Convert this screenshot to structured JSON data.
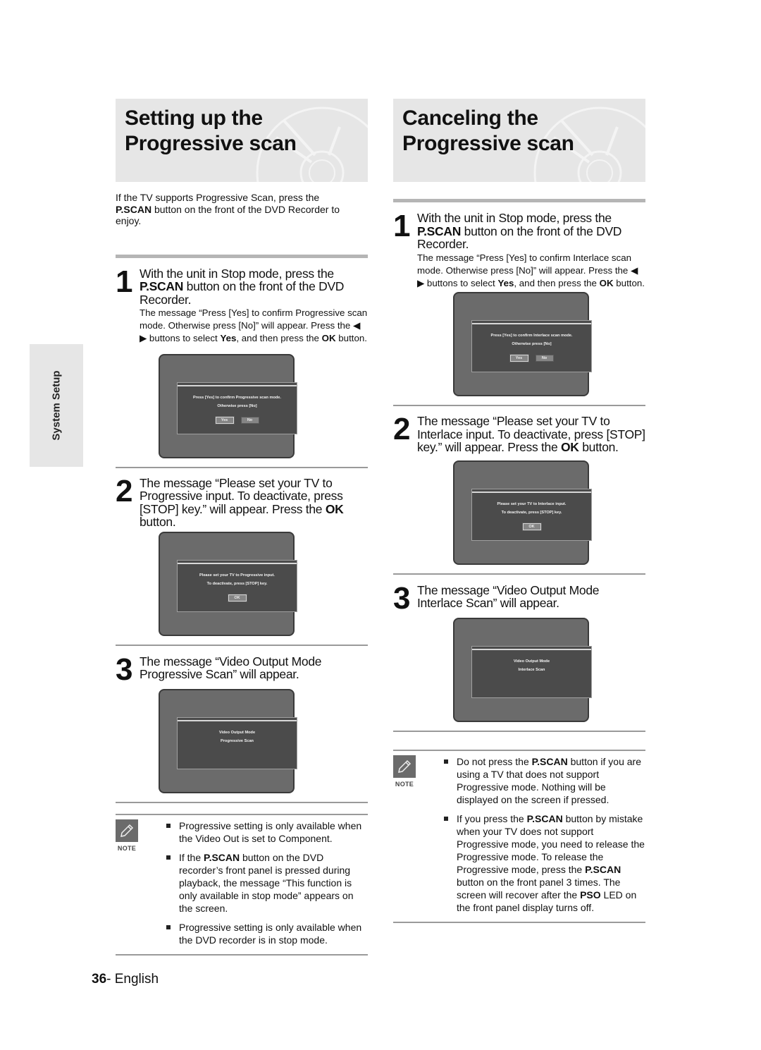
{
  "side_tab": {
    "label": "System Setup"
  },
  "left": {
    "title": "Setting up the Progressive scan",
    "intro_bold": "P.SCAN",
    "intro_pre": "If the TV supports Progressive Scan, press the",
    "intro_post": " button on the front of the DVD Recorder to enjoy.",
    "steps": [
      {
        "num": "1",
        "head_pre": "With the unit in Stop mode, press the",
        "head_bold": "P.SCAN",
        "head_post": " button on the front of the DVD Recorder.",
        "sub_pre": "The message “Press [Yes] to confirm Progressive scan mode. Otherwise press [No]” will appear. Press the ◀ ▶ buttons to select ",
        "sub_bold1": "Yes",
        "sub_mid": ", and then press the ",
        "sub_bold2": "OK",
        "sub_post": " button.",
        "screen": {
          "line1": "Press [Yes] to confirm Progressive scan mode.",
          "line2": "Otherwise press [No]",
          "buttons": [
            "Yes",
            "No"
          ],
          "selected": "Yes"
        }
      },
      {
        "num": "2",
        "head_pre": "The message “Please set your TV to Progressive input. To deactivate, press [STOP] key.” will appear. Press the ",
        "head_bold": "OK",
        "head_post": " button.",
        "screen": {
          "line1": "Please set your TV to Progressive input.",
          "line2": "To deactivate, press [STOP] key.",
          "buttons": [
            "OK"
          ],
          "selected": "OK"
        }
      },
      {
        "num": "3",
        "head_pre": "The message “Video Output Mode Progressive Scan” will appear.",
        "screen": {
          "line1": "Video Output Mode",
          "line2": "Progressive Scan"
        }
      }
    ],
    "note": {
      "label": "NOTE",
      "items": [
        {
          "pre": "Progressive setting is only available when the Video Out is set to Component."
        },
        {
          "pre": "If the ",
          "bold": "P.SCAN",
          "post": " button on the DVD recorder’s front panel is pressed during playback, the message “This function is only available in stop mode” appears on the screen."
        },
        {
          "pre": "Progressive setting is only available when the DVD recorder is in stop mode."
        }
      ]
    }
  },
  "right": {
    "title": "Canceling the Progressive scan",
    "steps": [
      {
        "num": "1",
        "head_pre": "With the unit in Stop mode, press the",
        "head_bold": "P.SCAN",
        "head_post": " button on the front of the DVD Recorder.",
        "sub_pre": "The message “Press [Yes] to confirm Interlace scan mode. Otherwise press [No]” will appear. Press the ◀ ▶ buttons to select ",
        "sub_bold1": "Yes",
        "sub_mid": ", and then press the ",
        "sub_bold2": "OK",
        "sub_post": " button.",
        "screen": {
          "line1": "Press [Yes] to confirm Interlace scan mode.",
          "line2": "Otherwise press [No]",
          "buttons": [
            "Yes",
            "No"
          ],
          "selected": "Yes"
        }
      },
      {
        "num": "2",
        "head_pre": "The message “Please set your TV to Interlace input. To deactivate, press [STOP] key.” will appear. Press the ",
        "head_bold": "OK",
        "head_post": " button.",
        "screen": {
          "line1": "Please set your TV to Interlace input.",
          "line2": "To deactivate, press [STOP] key.",
          "buttons": [
            "OK"
          ],
          "selected": "OK"
        }
      },
      {
        "num": "3",
        "head_pre": "The message “Video Output Mode Interlace Scan” will appear.",
        "screen": {
          "line1": "Video Output Mode",
          "line2": "Interlace Scan"
        }
      }
    ],
    "note": {
      "label": "NOTE",
      "items": [
        {
          "pre": "Do not press the ",
          "bold": "P.SCAN",
          "post": " button if you are using a TV that does not support Progressive mode. Nothing will be displayed on the screen if pressed."
        },
        {
          "pre": "If you press the ",
          "bold": "P.SCAN",
          "post": " button by mistake when your TV does not support Progressive mode, you need to release the Progressive mode. To release the Progressive mode, press the ",
          "bold2": "P.SCAN",
          "post2": " button on the front panel 3 times. The screen will recover after the ",
          "bold3": "PSO",
          "post3": " LED on the front panel display turns off."
        }
      ]
    }
  },
  "footer": {
    "page_number": "36",
    "language": "- English"
  }
}
